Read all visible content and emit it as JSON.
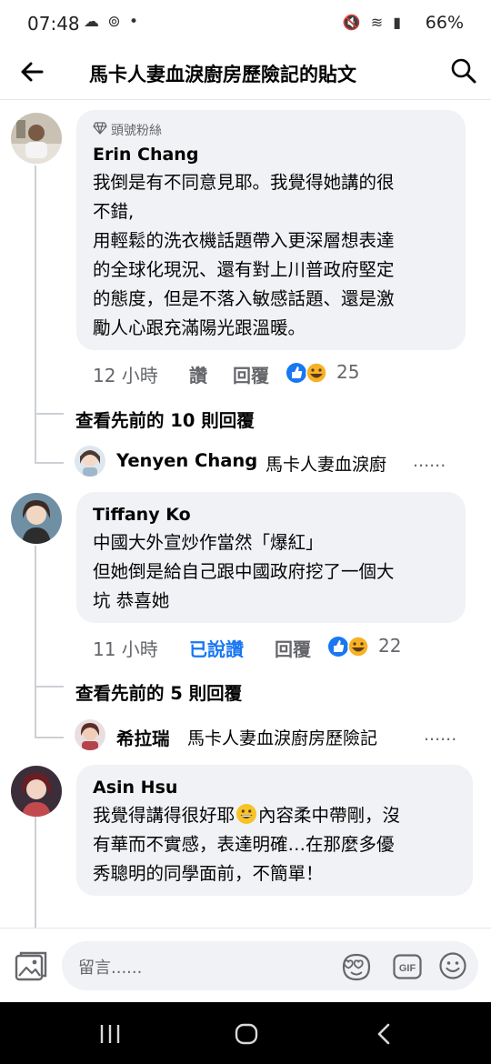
{
  "status": {
    "time": "07:48",
    "left_icons": "☁ ⊚ •",
    "battery": "66%",
    "right_icons": "🔇 ≋ ▮"
  },
  "header": {
    "title": "馬卡人妻血淚廚房歷險記的貼文"
  },
  "comments": [
    {
      "badge": "頭號粉絲",
      "author": "Erin Chang",
      "text": "我倒是有不同意見耶。我覺得她講的很\n不錯,\n用輕鬆的洗衣機話題帶入更深層想表達\n的全球化現況、還有對上川普政府堅定\n的態度，但是不落入敏感話題、還是激\n勵人心跟充滿陽光跟溫暖。",
      "time": "12 小時",
      "like_label": "讚",
      "reply_label": "回覆",
      "reaction_count": "25",
      "view_previous": "查看先前的 10 則回覆",
      "reply_preview": {
        "name": "Yenyen Chang",
        "snippet": "馬卡人妻血淚廚",
        "ellipsis": "......"
      }
    },
    {
      "author": "Tiffany Ko",
      "text": "中國大外宣炒作當然「爆紅」\n但她倒是給自己跟中國政府挖了一個大\n坑 恭喜她",
      "time": "11 小時",
      "like_label": "已說讚",
      "reply_label": "回覆",
      "reaction_count": "22",
      "view_previous": "查看先前的 5 則回覆",
      "reply_preview": {
        "name": "希拉瑞",
        "snippet": "馬卡人妻血淚廚房歷險記",
        "ellipsis": "......"
      }
    },
    {
      "author": "Asin Hsu",
      "text_part1": "我覺得講得很好耶",
      "text_part2": "內容柔中帶剛，沒",
      "text_rest": "有華而不實感，表達明確…在那麼多優\n秀聰明的同學面前，不簡單！"
    }
  ],
  "input": {
    "placeholder": "留言......",
    "gif_label": "GIF"
  },
  "colors": {
    "accent": "#1877f2",
    "bubble": "#f0f2f5",
    "secondary_text": "#65676b"
  }
}
